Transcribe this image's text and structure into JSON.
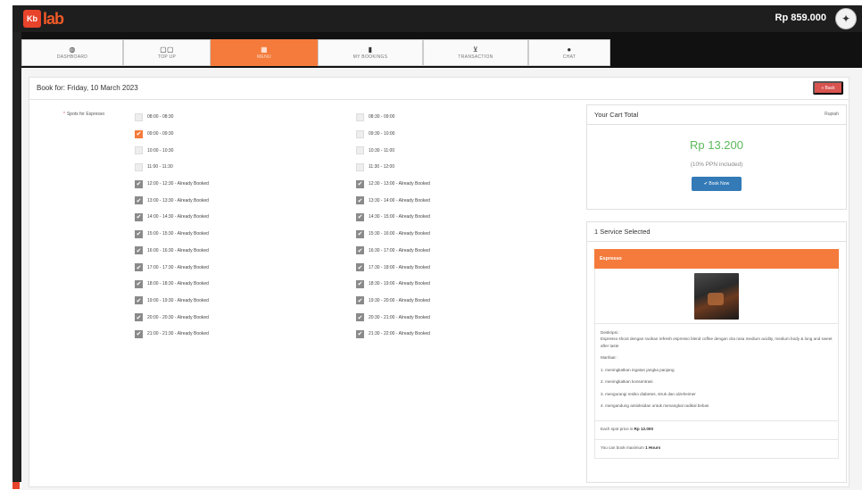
{
  "header": {
    "logo_badge": "Kb",
    "logo_text": "lab",
    "balance": "Rp 859.000"
  },
  "nav": [
    {
      "label": "DASHBOARD",
      "icon": "◍",
      "name": "nav-dashboard"
    },
    {
      "label": "TOP UP",
      "icon": "▢▢",
      "name": "nav-topup"
    },
    {
      "label": "MENU",
      "icon": "▦",
      "name": "nav-menu",
      "active": true
    },
    {
      "label": "MY BOOKINGS",
      "icon": "▮",
      "name": "nav-my-bookings"
    },
    {
      "label": "TRANSACTION",
      "icon": "⊻",
      "name": "nav-transaction"
    },
    {
      "label": "CHAT",
      "icon": "●",
      "name": "nav-chat"
    }
  ],
  "page": {
    "title": "Book for: Friday, 10 March 2023",
    "back_label": "« Back",
    "spots_label": "Spots for Espresso"
  },
  "slots_left": [
    {
      "time": "08:00 - 08:30",
      "state": "free"
    },
    {
      "time": "09:00 - 09:30",
      "state": "selected"
    },
    {
      "time": "10:00 - 10:30",
      "state": "free"
    },
    {
      "time": "11:00 - 11:30",
      "state": "free"
    },
    {
      "time": "12:00 - 12:30 - Already Booked",
      "state": "booked"
    },
    {
      "time": "13:00 - 13:30 - Already Booked",
      "state": "booked"
    },
    {
      "time": "14:00 - 14:30 - Already Booked",
      "state": "booked"
    },
    {
      "time": "15:00 - 15:30 - Already Booked",
      "state": "booked"
    },
    {
      "time": "16:00 - 16:30 - Already Booked",
      "state": "booked"
    },
    {
      "time": "17:00 - 17:30 - Already Booked",
      "state": "booked"
    },
    {
      "time": "18:00 - 18:30 - Already Booked",
      "state": "booked"
    },
    {
      "time": "19:00 - 19:30 - Already Booked",
      "state": "booked"
    },
    {
      "time": "20:00 - 20:30 - Already Booked",
      "state": "booked"
    },
    {
      "time": "21:00 - 21:30 - Already Booked",
      "state": "booked"
    }
  ],
  "slots_right": [
    {
      "time": "08:30 - 09:00",
      "state": "free"
    },
    {
      "time": "09:30 - 10:00",
      "state": "free"
    },
    {
      "time": "10:30 - 11:00",
      "state": "free"
    },
    {
      "time": "11:30 - 12:00",
      "state": "free"
    },
    {
      "time": "12:30 - 13:00 - Already Booked",
      "state": "booked"
    },
    {
      "time": "13:30 - 14:00 - Already Booked",
      "state": "booked"
    },
    {
      "time": "14:30 - 15:00 - Already Booked",
      "state": "booked"
    },
    {
      "time": "15:30 - 16:00 - Already Booked",
      "state": "booked"
    },
    {
      "time": "16:30 - 17:00 - Already Booked",
      "state": "booked"
    },
    {
      "time": "17:30 - 18:00 - Already Booked",
      "state": "booked"
    },
    {
      "time": "18:30 - 19:00 - Already Booked",
      "state": "booked"
    },
    {
      "time": "19:30 - 20:00 - Already Booked",
      "state": "booked"
    },
    {
      "time": "20:30 - 21:00 - Already Booked",
      "state": "booked"
    },
    {
      "time": "21:30 - 22:00 - Already Booked",
      "state": "booked"
    }
  ],
  "cart": {
    "title": "Your Cart Total",
    "currency": "Rupiah",
    "total": "Rp 13.200",
    "ppn": "(10% PPN included)",
    "book_label": "✔ Book Now"
  },
  "service": {
    "header": "1 Service Selected",
    "name": "Espresso",
    "desc_title": "Deskripsi :",
    "desc_text": "Espresso shoot dengan racikan refresh espresso blend coffee dengan cita rasa medium acidity, medium body & long and sweet after taste",
    "benefit_title": "Manfaat :",
    "benefits": [
      "1. meningkatkan ingatan jangka panjang",
      "2. meningkatkan konsentrasi",
      "3. mengurangi resiko diabetes, struk dan alzeheimer",
      "4. mengandung antioksidan untuk menangkal radikal bebas"
    ],
    "price_prefix": "Each spot price is ",
    "price_value": "Rp 12.000",
    "max_prefix": "You can book maximum ",
    "max_value": "1 Hours"
  },
  "colors": {
    "accent": "#f47b3b",
    "success": "#5cb85c",
    "primary": "#337ab7",
    "danger": "#d9534f"
  }
}
